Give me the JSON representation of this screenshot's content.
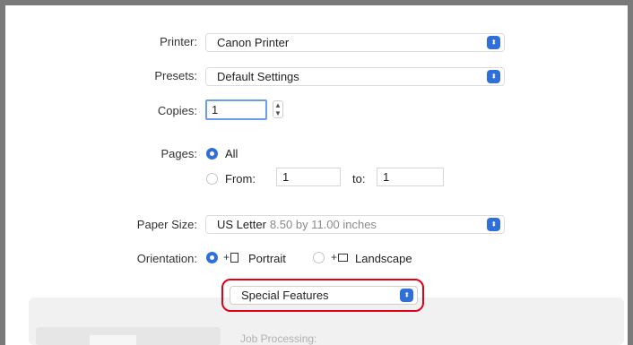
{
  "printer": {
    "label": "Printer:",
    "value": "Canon Printer"
  },
  "presets": {
    "label": "Presets:",
    "value": "Default Settings"
  },
  "copies": {
    "label": "Copies:",
    "value": "1"
  },
  "pages": {
    "label": "Pages:",
    "all_label": "All",
    "from_label": "From:",
    "from_value": "1",
    "to_label": "to:",
    "to_value": "1"
  },
  "paper_size": {
    "label": "Paper Size:",
    "value": "US Letter",
    "detail": "8.50 by 11.00 inches"
  },
  "orientation": {
    "label": "Orientation:",
    "portrait_label": "Portrait",
    "landscape_label": "Landscape",
    "selected": "portrait"
  },
  "features_popup": {
    "value": "Special Features"
  },
  "lower_panel": {
    "section_label": "Job Processing:"
  },
  "colors": {
    "accent": "#2f6fd9",
    "highlight": "#e2001a"
  }
}
